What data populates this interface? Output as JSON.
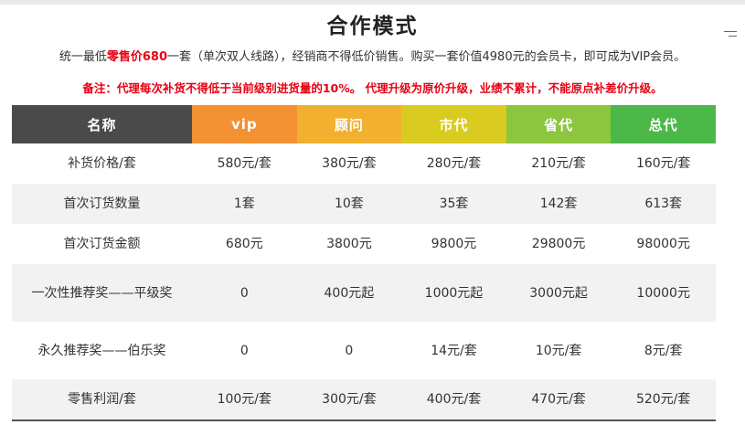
{
  "page": {
    "title": "合作模式",
    "intro": {
      "pre": "统一最低",
      "highlight": "零售价680",
      "post": "一套（单次双人线路），经销商不得低价销售。购买一套价值4980元的会员卡，即可成为VIP会员。"
    },
    "note": "备注：代理每次补货不得低于当前级别进货量的10%。 代理升级为原价升级，业绩不累计，不能原点补差价升级。"
  },
  "table": {
    "headers": [
      {
        "label": "名称",
        "color": "#4a4a4a"
      },
      {
        "label": "vip",
        "color": "#f39232"
      },
      {
        "label": "顾问",
        "color": "#f2b030"
      },
      {
        "label": "市代",
        "color": "#d9cb1f"
      },
      {
        "label": "省代",
        "color": "#8cc63f"
      },
      {
        "label": "总代",
        "color": "#4cb848"
      }
    ],
    "rows": [
      [
        "补货价格/套",
        "580元/套",
        "380元/套",
        "280元/套",
        "210元/套",
        "160元/套"
      ],
      [
        "首次订货数量",
        "1套",
        "10套",
        "35套",
        "142套",
        "613套"
      ],
      [
        "首次订货金额",
        "680元",
        "3800元",
        "9800元",
        "29800元",
        "98000元"
      ],
      [
        "一次性推荐奖——平级奖",
        "0",
        "400元起",
        "1000元起",
        "3000元起",
        "10000元"
      ],
      [
        "永久推荐奖——伯乐奖",
        "0",
        "0",
        "14元/套",
        "10元/套",
        "8元/套"
      ],
      [
        "零售利润/套",
        "100元/套",
        "300元/套",
        "400元/套",
        "470元/套",
        "520元/套"
      ]
    ]
  },
  "colors": {
    "accent_red": "#e60012"
  },
  "icons": {
    "menu": "menu-icon"
  }
}
